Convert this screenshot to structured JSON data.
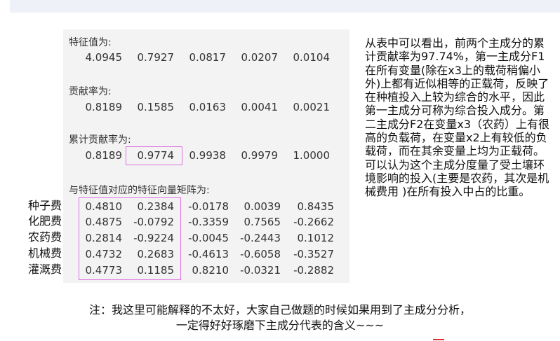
{
  "eigen": {
    "eig_label": "特征值为:",
    "eig_values": [
      "4.0945",
      "0.7927",
      "0.0817",
      "0.0207",
      "0.0104"
    ],
    "contrib_label": "贡献率为:",
    "contrib_values": [
      "0.8189",
      "0.1585",
      "0.0163",
      "0.0041",
      "0.0021"
    ],
    "cum_label": "累计贡献率为:",
    "cum_values": [
      "0.8189",
      "0.9774",
      "0.9938",
      "0.9979",
      "1.0000"
    ],
    "matrix_label": "与特征值对应的特征向量矩阵为:",
    "row_labels": [
      "种子费",
      "化肥费",
      "农药费",
      "机械费",
      "灌溉费"
    ],
    "matrix": [
      [
        "0.4810",
        "0.2384",
        "-0.0178",
        "0.0039",
        "0.8435"
      ],
      [
        "0.4875",
        "-0.0792",
        "-0.3359",
        "0.7565",
        "-0.2662"
      ],
      [
        "0.2814",
        "-0.9224",
        "-0.0045",
        "-0.2443",
        "0.1012"
      ],
      [
        "0.4732",
        "0.2683",
        "-0.4613",
        "-0.6058",
        "-0.3527"
      ],
      [
        "0.4773",
        "0.1185",
        "0.8210",
        "-0.0321",
        "-0.2882"
      ]
    ]
  },
  "explanation": "从表中可以看出，前两个主成分的累计贡献率为97.74%，第一主成分F1在所有变量(除在x3上的载荷稍偏小外)上都有近似相等的正载荷，反映了在种植投入上较为综合的水平，因此第一主成分可称为综合投入成分。第二主成分F2在变量x3（农药）上有很高的负载荷，在变量x2上有较低的负载荷，而在其余变量上均为正载荷。可以认为这个主成分度量了受土壤环境影响的投入(主要是农药，其次是机械费用 )在所有投入中占的比重。",
  "note": {
    "line1": "注：我这里可能解释的不太好，大家自己做题的时候如果用到了主成分分析，",
    "line2": "一定得好好琢磨下主成分代表的含义~~~"
  }
}
